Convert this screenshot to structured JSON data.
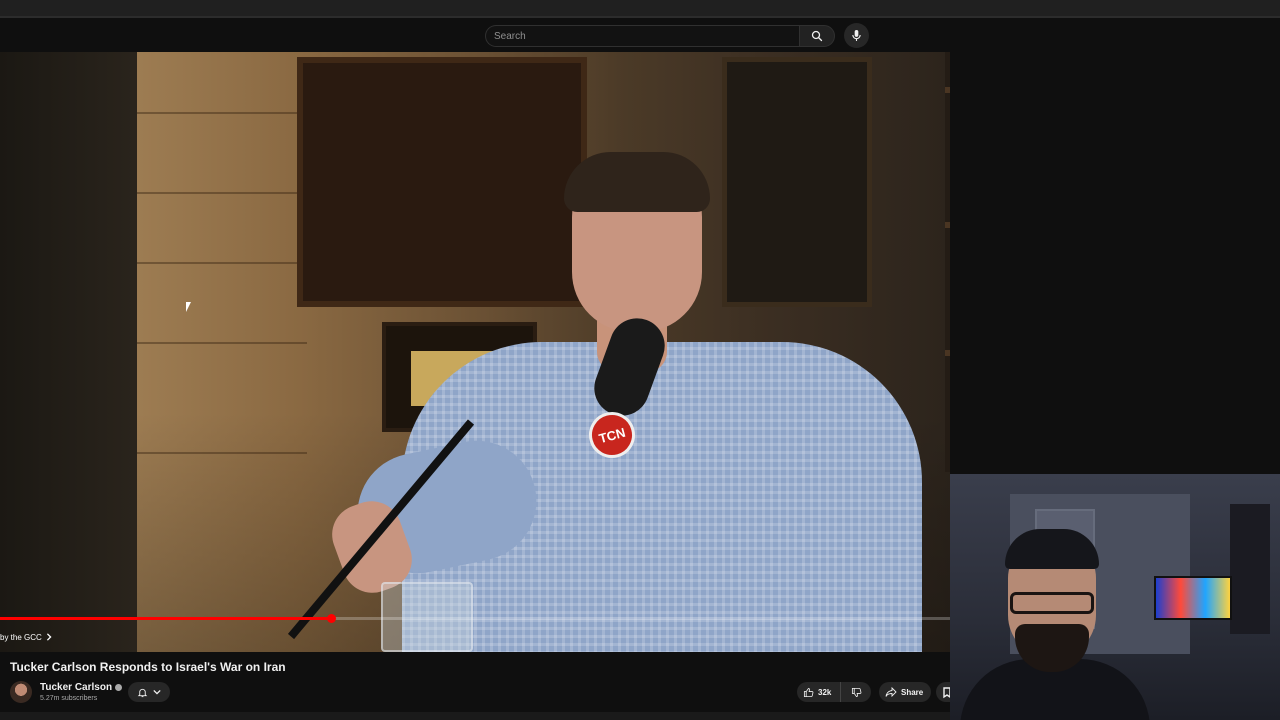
{
  "search": {
    "placeholder": "Search"
  },
  "player": {
    "chapter_label": "by the GCC",
    "progress_fraction": 0.348,
    "video_logo_text": "TCN"
  },
  "video": {
    "title": "Tucker Carlson Responds to Israel's War on Iran"
  },
  "channel": {
    "name": "Tucker Carlson",
    "subscribers": "5.27m subscribers"
  },
  "actions": {
    "like_count": "32k",
    "share_label": "Share"
  },
  "colors": {
    "accent": "#ff0000",
    "background": "#0f0f0f",
    "pill": "#272727"
  }
}
